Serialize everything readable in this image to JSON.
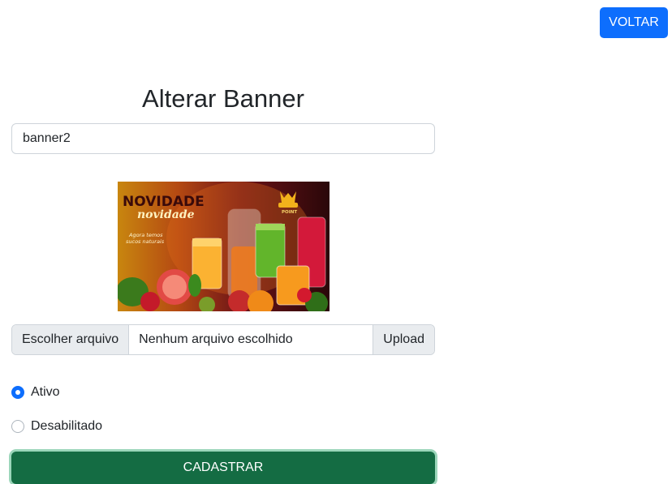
{
  "header": {
    "back_label": "VOLTAR"
  },
  "form": {
    "title": "Alterar Banner",
    "name_value": "banner2",
    "banner": {
      "headline": "NOVIDADE",
      "script_text": "novidade",
      "tagline_line1": "Agora temos",
      "tagline_line2": "sucos naturais",
      "logo_text": "POINT"
    },
    "file": {
      "choose_label": "Escolher arquivo",
      "status": "Nenhum arquivo escolhido",
      "upload_label": "Upload"
    },
    "status_options": [
      {
        "label": "Ativo",
        "checked": true
      },
      {
        "label": "Desabilitado",
        "checked": false
      }
    ],
    "submit_label": "CADASTRAR"
  }
}
